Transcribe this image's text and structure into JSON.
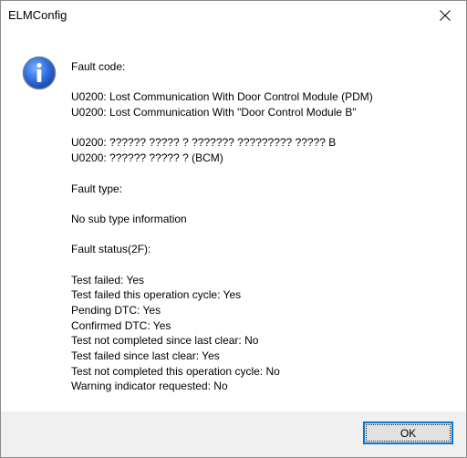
{
  "window": {
    "title": "ELMConfig"
  },
  "icon": {
    "name": "info-icon",
    "accent": "#2a5bbf"
  },
  "message": {
    "lines": [
      "Fault code:",
      "",
      "U0200: Lost Communication With Door Control Module (PDM)",
      "U0200: Lost Communication With \"Door Control Module B\"",
      "",
      "U0200: ?????? ????? ? ??????? ????????? ????? B",
      "U0200: ?????? ????? ? (BCM)",
      "",
      "Fault type:",
      "",
      "No sub type information",
      "",
      "Fault status(2F):",
      "",
      "Test failed: Yes",
      "Test failed this operation cycle: Yes",
      "Pending DTC: Yes",
      "Confirmed DTC: Yes",
      "Test not completed since last clear: No",
      "Test failed since last clear: Yes",
      "Test not completed this operation cycle: No",
      "Warning indicator requested: No"
    ]
  },
  "buttons": {
    "ok_label": "OK"
  },
  "colors": {
    "footer_bg": "#f0f0f0",
    "focus_border": "#0078d7"
  }
}
